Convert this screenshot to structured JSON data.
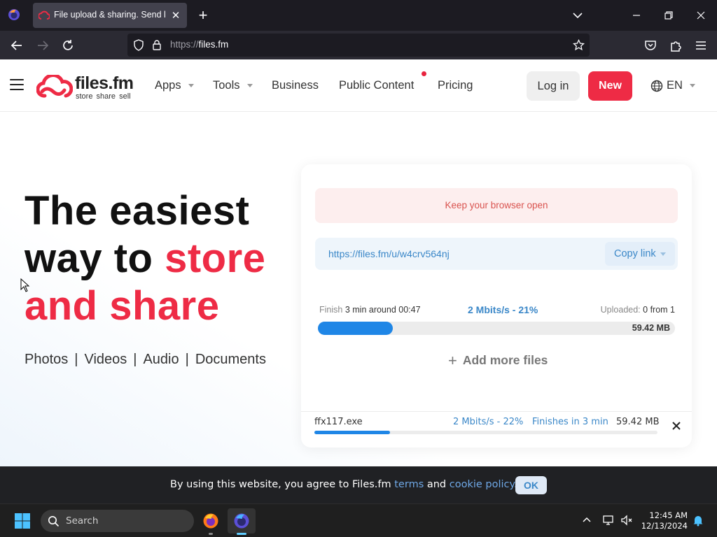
{
  "browser": {
    "tab_title": "File upload & sharing. Send large files",
    "url_protocol": "https://",
    "url_host": "files.fm",
    "tab_close": "✕",
    "new_tab": "+"
  },
  "site": {
    "logo_name": "files.fm",
    "logo_tagline": "store share sell",
    "nav": [
      {
        "label": "Apps"
      },
      {
        "label": "Tools"
      },
      {
        "label": "Business"
      },
      {
        "label": "Public Content"
      },
      {
        "label": "Pricing"
      }
    ],
    "login_label": "Log in",
    "new_label": "New",
    "language": "EN",
    "accent_color": "#ee2b45",
    "link_color": "#3a87c8"
  },
  "hero": {
    "title_line1": "The easiest",
    "title_line2_plain": "way to ",
    "title_line2_accent": "store",
    "title_line3_accent": "and share",
    "categories": [
      "Photos",
      "Videos",
      "Audio",
      "Documents"
    ],
    "separator": "|"
  },
  "upload": {
    "notice": "Keep your browser open",
    "share_link": "https://files.fm/u/w4crv564nj",
    "copy_label": "Copy link",
    "finish_prefix": "Finish",
    "finish_value": "3 min around 00:47",
    "speed_summary": "2 Mbits/s - 21%",
    "uploaded_prefix": "Uploaded:",
    "uploaded_value": "0 from 1",
    "total_size": "59.42 MB",
    "progress_fraction": 0.21,
    "add_more_label": "Add more files",
    "add_more_icon": "+",
    "file": {
      "name": "ffx117.exe",
      "speed": "2 Mbits/s - 22%",
      "eta": "Finishes in 3 min",
      "size": "59.42 MB",
      "progress_fraction": 0.22
    }
  },
  "cookie": {
    "text_before": "By using this website, you agree to Files.fm ",
    "terms_link": "terms",
    "text_middle": " and ",
    "policy_link": "cookie policy.",
    "ok_label": "OK"
  },
  "taskbar": {
    "search_placeholder": "Search",
    "time": "12:45 AM",
    "date": "12/13/2024"
  }
}
